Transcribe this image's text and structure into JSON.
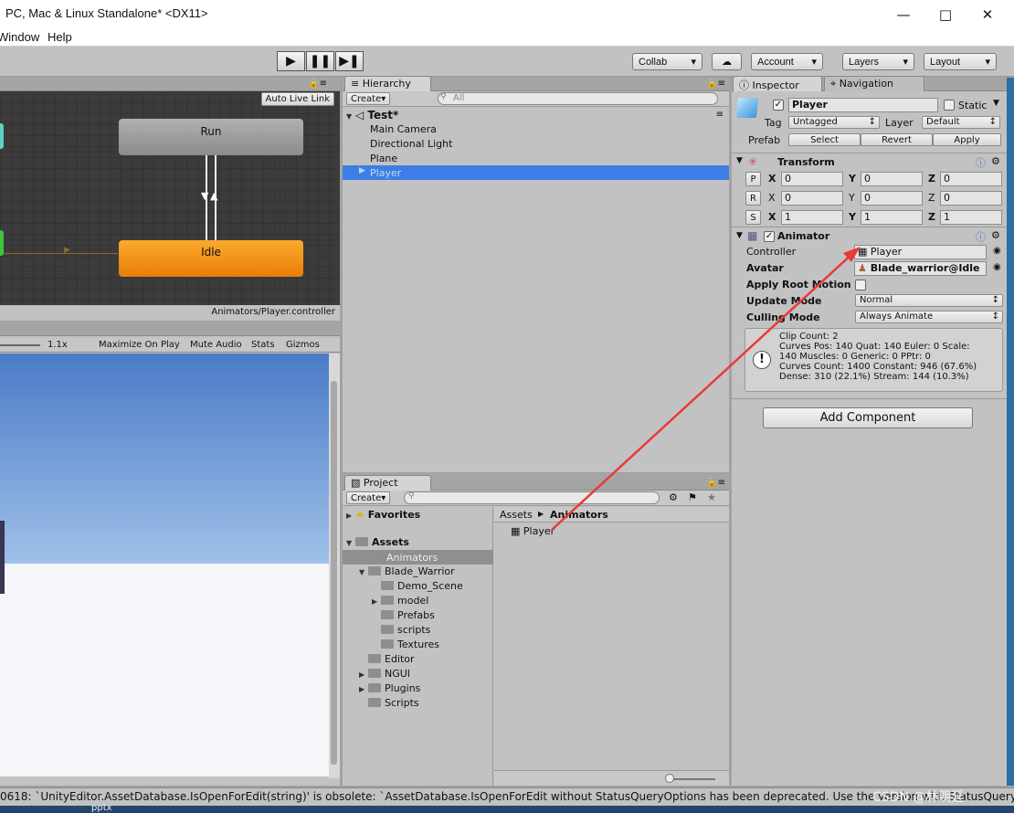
{
  "window": {
    "title": "PC, Mac & Linux Standalone* <DX11>"
  },
  "menu": {
    "items": [
      "Window",
      "Help"
    ]
  },
  "toolbar": {
    "collab": "Collab",
    "account": "Account",
    "layers": "Layers",
    "layout": "Layout"
  },
  "animator": {
    "auto_live_link": "Auto Live Link",
    "state_run": "Run",
    "state_idle": "Idle",
    "path": "Animators/Player.controller"
  },
  "game_view": {
    "scale": "1.1x",
    "maximize": "Maximize On Play",
    "mute": "Mute Audio",
    "stats": "Stats",
    "gizmos": "Gizmos"
  },
  "hierarchy": {
    "tab": "Hierarchy",
    "create": "Create",
    "search_placeholder": "All",
    "scene": "Test*",
    "items": [
      "Main Camera",
      "Directional Light",
      "Plane",
      "Player"
    ]
  },
  "project": {
    "tab": "Project",
    "create": "Create",
    "favorites": "Favorites",
    "assets": "Assets",
    "tree": [
      "Animators",
      "Blade_Warrior",
      "Demo_Scene",
      "model",
      "Prefabs",
      "scripts",
      "Textures",
      "Editor",
      "NGUI",
      "Plugins",
      "Scripts"
    ],
    "breadcrumb": {
      "root": "Assets",
      "current": "Animators"
    },
    "asset_file": "Player"
  },
  "inspector": {
    "tab": "Inspector",
    "nav_tab": "Navigation",
    "object_name": "Player",
    "static_label": "Static",
    "tag_label": "Tag",
    "tag_value": "Untagged",
    "layer_label": "Layer",
    "layer_value": "Default",
    "prefab_label": "Prefab",
    "select": "Select",
    "revert": "Revert",
    "apply": "Apply",
    "transform": {
      "title": "Transform",
      "rows": [
        {
          "btn": "P",
          "x": "0",
          "y": "0",
          "z": "0"
        },
        {
          "btn": "R",
          "x": "0",
          "y": "0",
          "z": "0"
        },
        {
          "btn": "S",
          "x": "1",
          "y": "1",
          "z": "1"
        }
      ],
      "x_label": "X",
      "y_label": "Y",
      "z_label": "Z"
    },
    "animator": {
      "title": "Animator",
      "controller_label": "Controller",
      "controller_value": "Player",
      "avatar_label": "Avatar",
      "avatar_value": "Blade_warrior@Idle",
      "root_motion_label": "Apply Root Motion",
      "update_mode_label": "Update Mode",
      "update_mode_value": "Normal",
      "culling_label": "Culling Mode",
      "culling_value": "Always Animate",
      "info": [
        "Clip Count: 2",
        "Curves Pos: 140 Quat: 140 Euler: 0 Scale:",
        "140 Muscles: 0 Generic: 0 PPtr: 0",
        "Curves Count: 1400 Constant: 946 (67.6%)",
        "Dense: 310 (22.1%) Stream: 144 (10.3%)"
      ]
    },
    "add_component": "Add Component"
  },
  "console": {
    "message": "0618: `UnityEditor.AssetDatabase.IsOpenForEdit(string)' is obsolete: `AssetDatabase.IsOpenForEdit without StatusQueryOptions has been deprecated. Use the version with StatusQueryOptions"
  },
  "watermark": "CSDN @林明延",
  "desktop_fragment": "pptx",
  "colors": {
    "selection": "#3d7ee6",
    "idle_state": "#f28c0f",
    "run_state": "#9a9a9a",
    "arrow": "#e83a3a"
  }
}
